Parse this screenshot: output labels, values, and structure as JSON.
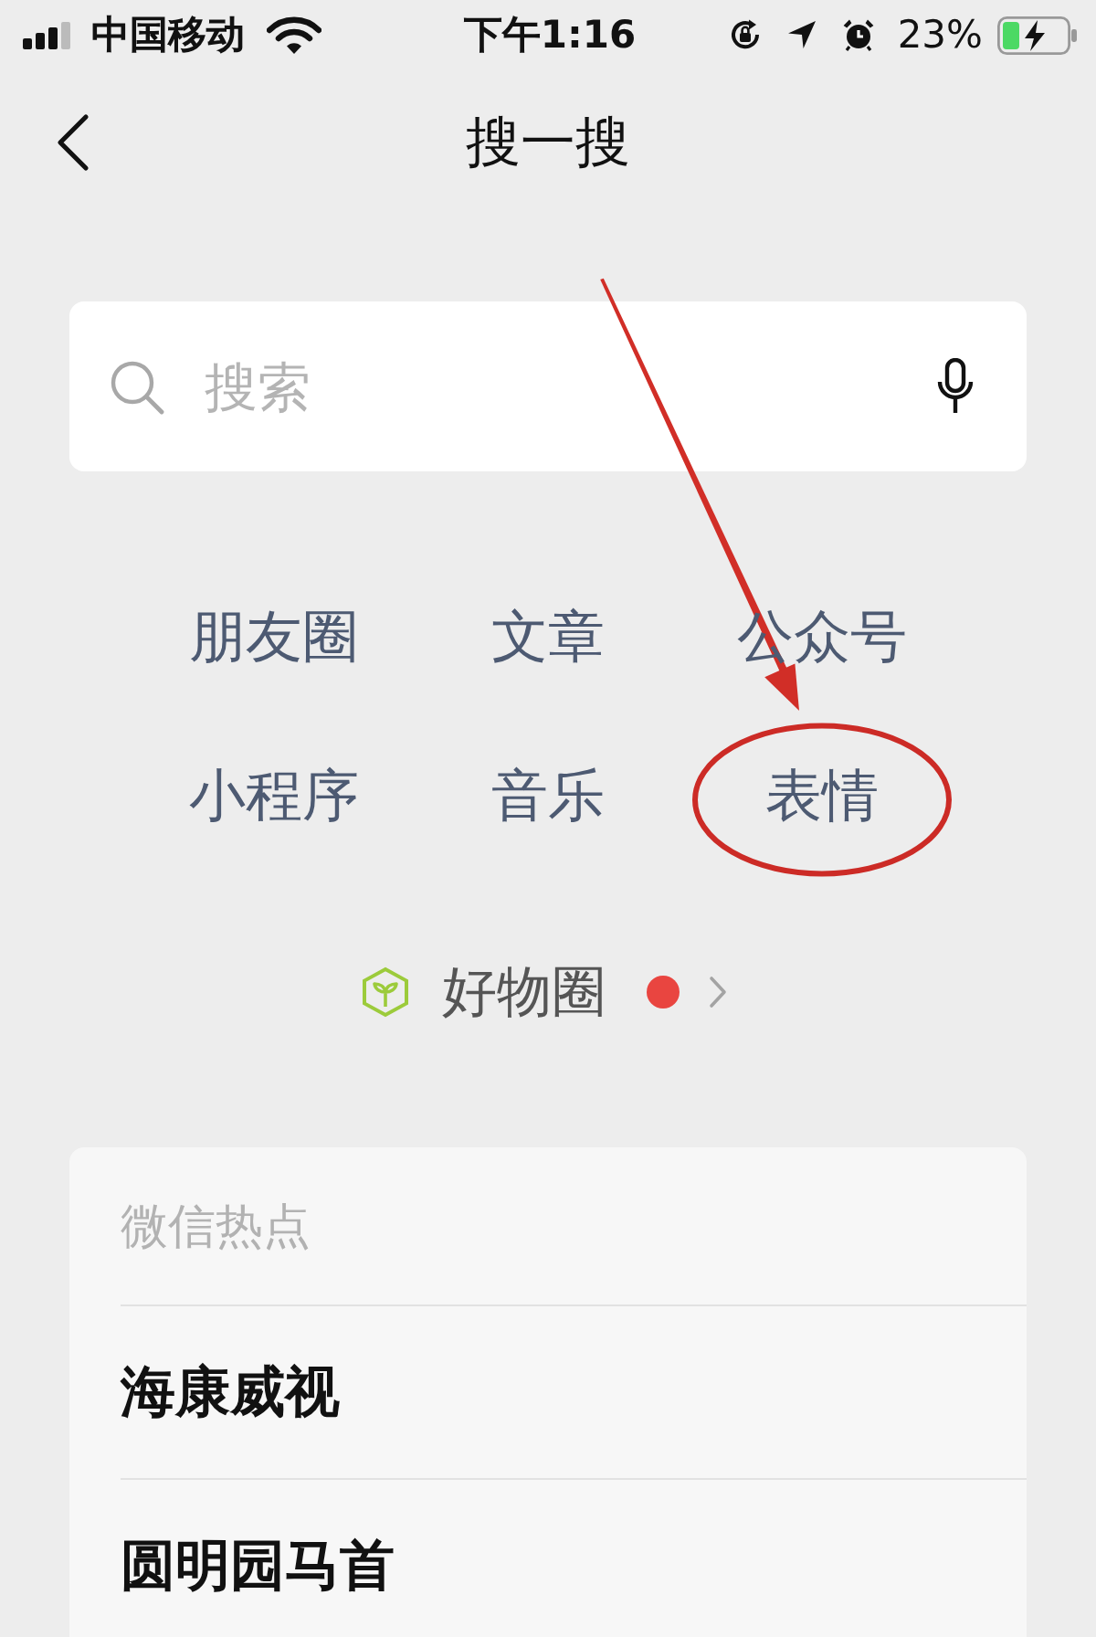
{
  "status_bar": {
    "carrier": "中国移动",
    "time": "下午1:16",
    "battery": "23%"
  },
  "nav": {
    "title": "搜一搜"
  },
  "search": {
    "placeholder": "搜索"
  },
  "categories": [
    {
      "label": "朋友圈",
      "circled": false
    },
    {
      "label": "文章",
      "circled": false
    },
    {
      "label": "公众号",
      "circled": false
    },
    {
      "label": "小程序",
      "circled": false
    },
    {
      "label": "音乐",
      "circled": false
    },
    {
      "label": "表情",
      "circled": true
    }
  ],
  "featured": {
    "label": "好物圈",
    "dot": true
  },
  "hot": {
    "title": "微信热点",
    "items": [
      "海康威视",
      "圆明园马首"
    ]
  }
}
